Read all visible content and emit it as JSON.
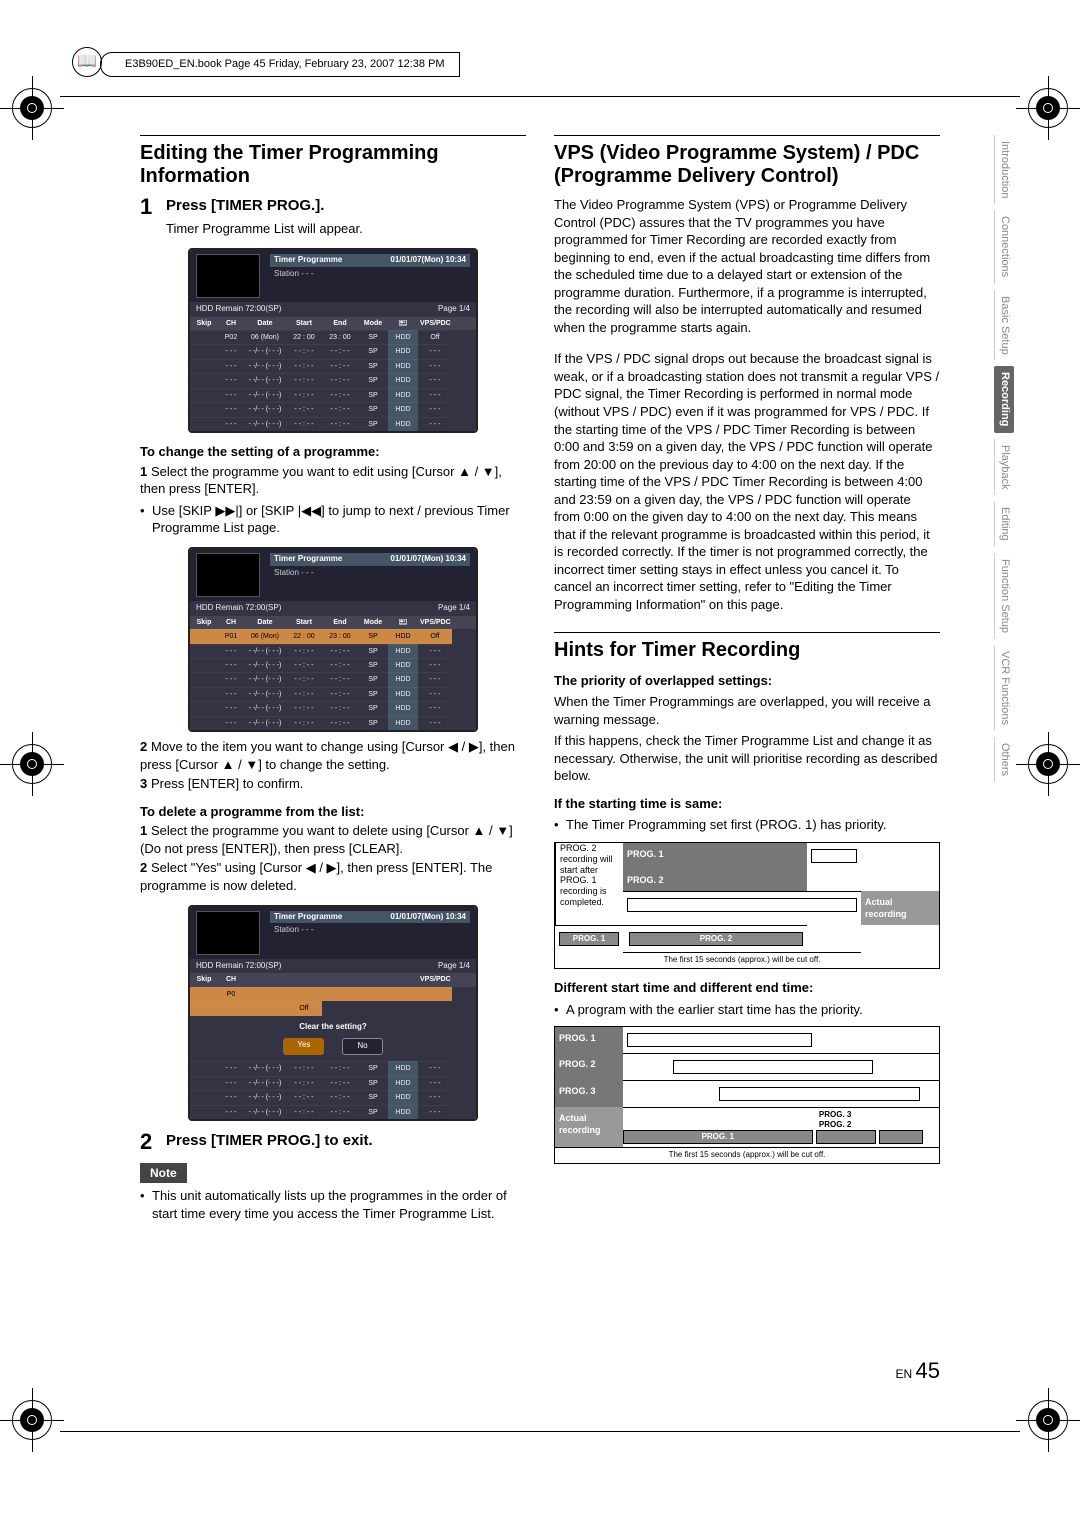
{
  "book_info": "E3B90ED_EN.book  Page 45  Friday, February 23, 2007  12:38 PM",
  "left": {
    "heading": "Editing the Timer Programming Information",
    "step1_label": "Press [TIMER PROG.].",
    "step1_body": "Timer Programme List will appear.",
    "sub_change": "To change the setting of a programme:",
    "change_steps": [
      "Select the programme you want to edit using [Cursor ▲ / ▼], then press [ENTER].",
      "Use [SKIP ▶▶|] or [SKIP |◀◀] to jump to next / previous Timer Programme List page."
    ],
    "move_steps": [
      "Move to the item you want to change using [Cursor ◀ / ▶], then press [Cursor ▲ / ▼] to change the setting.",
      "Press [ENTER] to confirm."
    ],
    "sub_delete": "To delete a programme from the list:",
    "delete_steps": [
      "Select the programme you want to delete using [Cursor ▲ / ▼] (Do not press [ENTER]), then press [CLEAR].",
      "Select \"Yes\" using [Cursor ◀ / ▶], then press [ENTER]. The programme is now deleted."
    ],
    "step2_label": "Press [TIMER PROG.] to exit.",
    "note_label": "Note",
    "note_body": "This unit automatically lists up the programmes in the order of start time every time you access the Timer Programme List."
  },
  "right": {
    "heading_vps": "VPS (Video Programme System) / PDC (Programme Delivery Control)",
    "vps_body1": "The Video Programme System (VPS) or Programme Delivery Control (PDC) assures that the TV programmes you have programmed for Timer Recording are recorded exactly from beginning to end, even if the actual broadcasting time differs from the scheduled time due to a delayed start or extension of the programme duration. Furthermore, if a programme is interrupted, the recording will also be interrupted automatically and resumed when the programme starts again.",
    "vps_body2": "If the VPS / PDC signal drops out because the broadcast signal is weak, or if a broadcasting station does not transmit a regular VPS / PDC signal, the Timer Recording is performed in normal mode (without VPS / PDC) even if it was programmed for VPS / PDC. If the starting time of the VPS / PDC Timer Recording is between 0:00 and 3:59 on a given day, the VPS / PDC function will operate from 20:00 on the previous day to 4:00 on the next day. If the starting time of the VPS / PDC Timer Recording is between 4:00 and 23:59 on a given day, the VPS / PDC function will operate from 0:00 on the given day to 4:00 on the next day. This means that if the relevant programme is broadcasted within this period, it is recorded correctly. If the timer is not programmed correctly, the incorrect timer setting stays in effect unless you cancel it. To cancel an incorrect timer setting, refer to \"Editing the Timer Programming Information\" on this page.",
    "heading_hints": "Hints for Timer Recording",
    "pri_heading": "The priority of overlapped settings:",
    "pri_body1": "When the Timer Programmings are overlapped, you will receive a warning message.",
    "pri_body2": "If this happens, check the Timer Programme List and change it as necessary. Otherwise, the unit will prioritise recording as described below.",
    "if_same": "If the starting time is same:",
    "if_same_bullet": "The Timer Programming set first (PROG. 1) has priority.",
    "diag1": {
      "prog1": "PROG. 1",
      "prog2": "PROG. 2",
      "actual": "Actual recording",
      "footer": "The first 15 seconds (approx.) will be cut off.",
      "side": "PROG. 2 recording will start after PROG. 1 recording is completed."
    },
    "diff_heading": "Different start time and different end time:",
    "diff_bullet": "A program with the earlier start time has the priority.",
    "diag2": {
      "prog1": "PROG. 1",
      "prog2": "PROG. 2",
      "prog3": "PROG. 3",
      "actual": "Actual recording",
      "footer": "The first 15 seconds (approx.) will be cut off."
    }
  },
  "tp": {
    "title": "Timer Programme",
    "datetime": "01/01/07(Mon) 10:34",
    "station_label": "Station",
    "station_value": "- - -",
    "hdd_remain": "HDD Remain   72:00(SP)",
    "page": "Page 1/4",
    "headers": [
      "Skip",
      "CH",
      "Date",
      "Start",
      "End",
      "Mode",
      "🖭",
      "VPS/PDC"
    ],
    "row_filled": [
      "",
      "P02",
      "06 (Mon)",
      "22 : 00",
      "23 : 00",
      "SP",
      "HDD",
      "Off"
    ],
    "row_sel": [
      "",
      "P01",
      "06 (Mon)",
      "22 : 00",
      "23 : 00",
      "SP",
      "HDD",
      "Off"
    ],
    "row_empty": [
      "",
      "- - -",
      "- -/- - (- - -)",
      "- - : - -",
      "- - : - -",
      "SP",
      "HDD",
      "- - -"
    ],
    "clear_q": "Clear the setting?",
    "yes": "Yes",
    "no": "No"
  },
  "tabs": [
    "Introduction",
    "Connections",
    "Basic Setup",
    "Recording",
    "Playback",
    "Editing",
    "Function Setup",
    "VCR Functions",
    "Others"
  ],
  "active_tab": 3,
  "page_number_prefix": "EN",
  "page_number": "45"
}
